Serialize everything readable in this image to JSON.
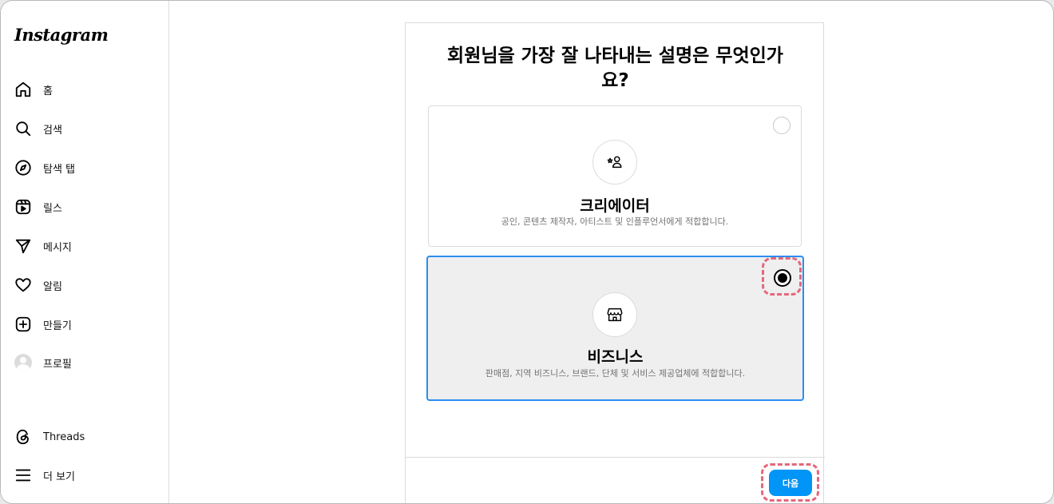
{
  "sidebar": {
    "logo": "Instagram",
    "items": [
      {
        "label": "홈",
        "icon": "home-icon"
      },
      {
        "label": "검색",
        "icon": "search-icon"
      },
      {
        "label": "탐색 탭",
        "icon": "compass-icon"
      },
      {
        "label": "릴스",
        "icon": "reels-icon"
      },
      {
        "label": "메시지",
        "icon": "send-icon"
      },
      {
        "label": "알림",
        "icon": "heart-icon"
      },
      {
        "label": "만들기",
        "icon": "plus-square-icon"
      },
      {
        "label": "프로필",
        "icon": "avatar-icon"
      }
    ],
    "bottom_items": [
      {
        "label": "Threads",
        "icon": "threads-icon"
      },
      {
        "label": "더 보기",
        "icon": "menu-icon"
      }
    ]
  },
  "main": {
    "title_line1": "회원님을 가장 잘 나타내는 설명은 무엇인가",
    "title_line2": "요?",
    "options": [
      {
        "title": "크리에이터",
        "description": "공인, 콘텐츠 제작자, 아티스트 및 인플루언서에게 적합합니다.",
        "icon": "creator-icon",
        "selected": false
      },
      {
        "title": "비즈니스",
        "description": "판매점, 지역 비즈니스, 브랜드, 단체 및 서비스 제공업체에 적합합니다.",
        "icon": "shop-icon",
        "selected": true
      }
    ],
    "next_label": "다음"
  },
  "colors": {
    "accent": "#0095f6",
    "selected_border": "#2a8ef0",
    "highlight": "#e4687b"
  }
}
